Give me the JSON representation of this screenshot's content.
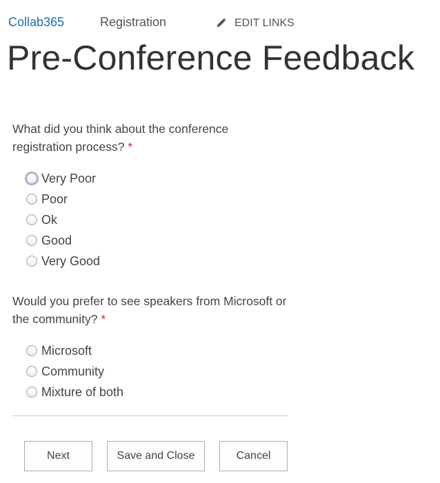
{
  "nav": {
    "home": "Collab365",
    "registration": "Registration",
    "edit_links": "EDIT LINKS",
    "edit_icon": "pencil-icon"
  },
  "page": {
    "title": "Pre-Conference Feedback"
  },
  "questions": [
    {
      "text": "What did you think about the conference registration process?",
      "required_marker": "*",
      "options": [
        "Very Poor",
        "Poor",
        "Ok",
        "Good",
        "Very Good"
      ],
      "focused_option": "Very Poor",
      "selected": ""
    },
    {
      "text": "Would you prefer to see speakers from Microsoft or the community?",
      "required_marker": "*",
      "options": [
        "Microsoft",
        "Community",
        "Mixture of both"
      ],
      "selected": ""
    }
  ],
  "buttons": {
    "next": "Next",
    "save_and_close": "Save and Close",
    "cancel": "Cancel"
  },
  "colors": {
    "link": "#1a6fb4",
    "required": "#c0392b",
    "text": "#444444"
  }
}
